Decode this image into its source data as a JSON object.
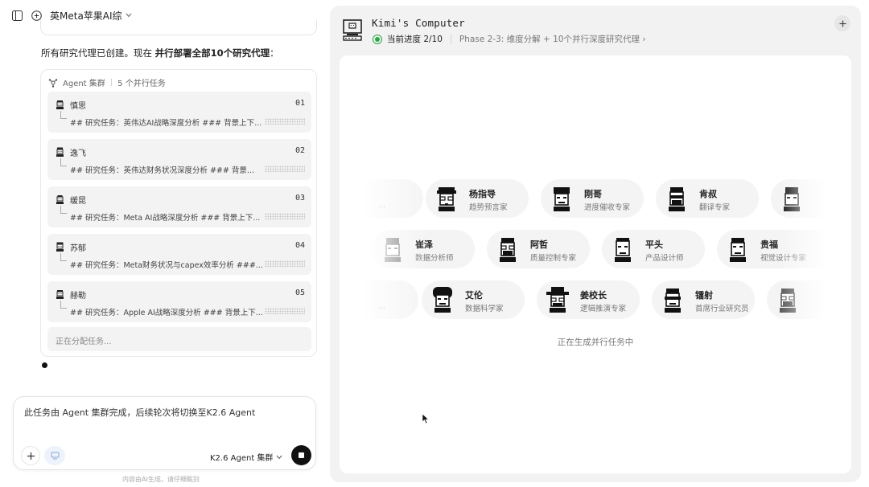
{
  "conversation": {
    "title": "英Meta苹果AI综"
  },
  "message": {
    "prefix": "所有研究代理已创建。现在 ",
    "bold": "并行部署全部10个研究代理",
    "suffix": "："
  },
  "cluster": {
    "label": "Agent 集群",
    "count": "5 个并行任务",
    "tasks": [
      {
        "name": "慎思",
        "num": "01",
        "desc": "## 研究任务：英伟达AI战略深度分析 ### 背景上下..."
      },
      {
        "name": "逸飞",
        "num": "02",
        "desc": "## 研究任务：英伟达财务状况深度分析 ### 背景..."
      },
      {
        "name": "缓昆",
        "num": "03",
        "desc": "## 研究任务：Meta AI战略深度分析 ### 背景上下..."
      },
      {
        "name": "苏郁",
        "num": "04",
        "desc": "## 研究任务：Meta财务状况与capex效率分析 ###..."
      },
      {
        "name": "赫勒",
        "num": "05",
        "desc": "## 研究任务：Apple AI战略深度分析 ### 背景上下..."
      }
    ],
    "assigning": "正在分配任务..."
  },
  "composer": {
    "text": "此任务由 Agent 集群完成，后续轮次将切换至K2.6 Agent",
    "model": "K2.6 Agent 集群"
  },
  "footnote": "内容由AI生成，请仔细甄别",
  "computer": {
    "title": "Kimi's Computer",
    "progress": "当前进度 2/10",
    "phase": "Phase 2-3: 维度分解 + 10个并行深度研究代理 ›",
    "status": "正在生成并行任务中"
  },
  "agents": {
    "row1": [
      {
        "name": "",
        "role": "..."
      },
      {
        "name": "杨指导",
        "role": "趋势预言家"
      },
      {
        "name": "刚哥",
        "role": "进度催收专家"
      },
      {
        "name": "肯叔",
        "role": "翻译专家"
      },
      {
        "name": "",
        "role": ""
      }
    ],
    "row2": [
      {
        "name": "崔泽",
        "role": "数据分析师"
      },
      {
        "name": "阿哲",
        "role": "质量控制专家"
      },
      {
        "name": "平头",
        "role": "产品设计师"
      },
      {
        "name": "贵福",
        "role": "视觉设计专家"
      }
    ],
    "row3": [
      {
        "name": "",
        "role": "..."
      },
      {
        "name": "艾伦",
        "role": "数据科学家"
      },
      {
        "name": "姜校长",
        "role": "逻辑推演专家"
      },
      {
        "name": "镭射",
        "role": "首席行业研究员"
      },
      {
        "name": "",
        "role": ""
      }
    ]
  },
  "colors": {
    "progress": "#27a844",
    "stop": "#111111",
    "panel": "#f2f2f2"
  }
}
